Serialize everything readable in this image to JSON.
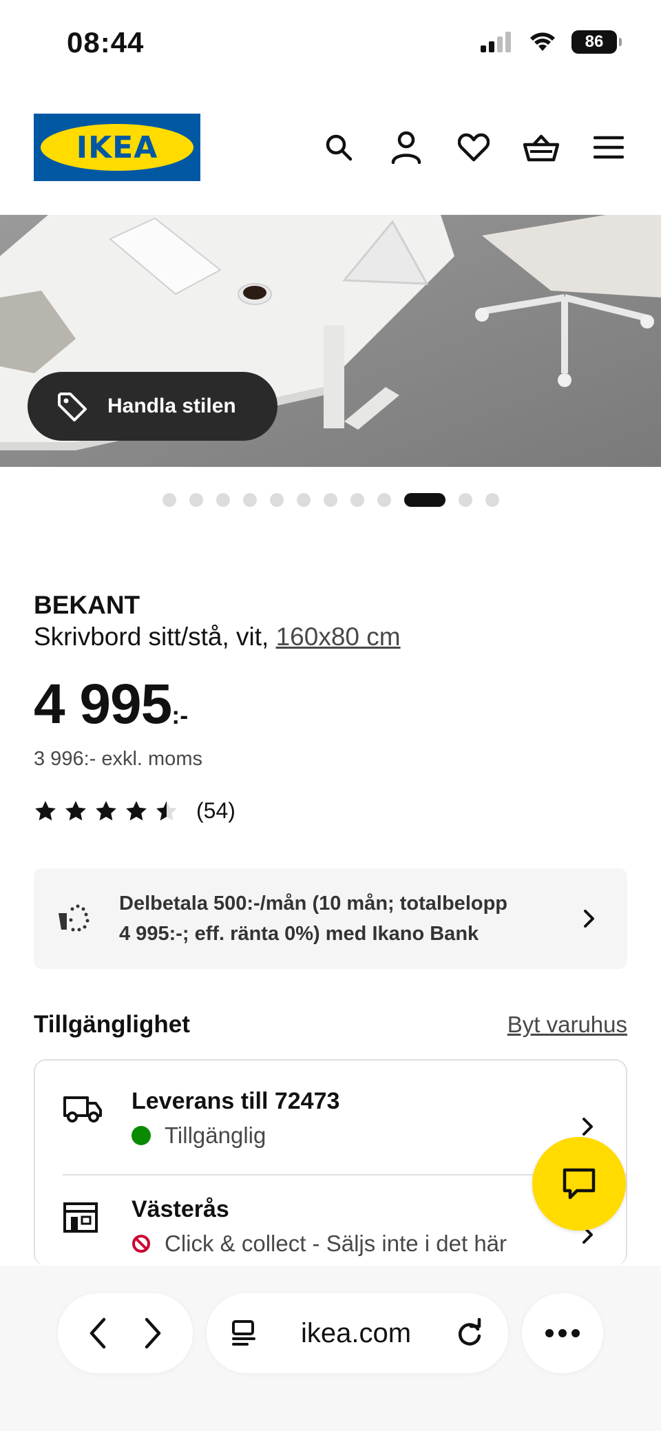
{
  "status_bar": {
    "time": "08:44",
    "battery": "86"
  },
  "header": {
    "logo_text": "IKEA",
    "icons": [
      "search-icon",
      "account-icon",
      "heart-icon",
      "basket-icon",
      "menu-icon"
    ]
  },
  "hero": {
    "shop_style_label": "Handla stilen",
    "carousel_total": 12,
    "carousel_active_index": 9
  },
  "product": {
    "name": "BEKANT",
    "description": "Skrivbord sitt/stå, vit, ",
    "size_link": "160x80 cm",
    "price": "4 995",
    "price_suffix": ":-",
    "price_excl_vat": "3 996:- exkl. moms",
    "rating_value": 4.5,
    "rating_max": 5,
    "rating_count": "(54)"
  },
  "payment": {
    "text_line1": "Delbetala 500:-/mån (10 mån; totalbelopp",
    "text_line2": "4 995:-; eff. ränta 0%) med Ikano Bank"
  },
  "availability": {
    "title": "Tillgänglighet",
    "change_store_link": "Byt varuhus",
    "delivery": {
      "title": "Leverans till 72473",
      "status": "Tillgänglig",
      "status_color": "#0a8a00"
    },
    "store": {
      "title": "Västerås",
      "status": "Click & collect - Säljs inte i det här",
      "status_color": "#cc0033"
    }
  },
  "browser": {
    "url": "ikea.com"
  },
  "colors": {
    "ikea_blue": "#0058a3",
    "ikea_yellow": "#ffdb00"
  }
}
